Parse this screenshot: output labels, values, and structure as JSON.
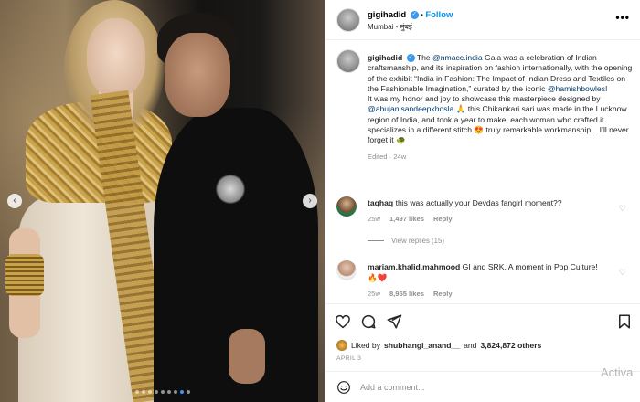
{
  "post": {
    "username": "gigihadid",
    "follow_label": "Follow",
    "location": "Mumbai - मुंबई",
    "more_icon": "more-horizontal-icon"
  },
  "caption": {
    "username": "gigihadid",
    "text_1": "The ",
    "mention_1": "@nmacc.india",
    "text_2": " Gala was a celebration of Indian craftsmanship, and its inspiration on fashion internationally, with the opening of the exhibit “India in Fashion: The Impact of Indian Dress and Textiles on the Fashionable Imagination,” curated by the iconic ",
    "mention_2": "@hamishbowles",
    "text_3": "!",
    "text_4": "It was my honor and joy to showcase this masterpiece designed by ",
    "mention_3": "@abujanisandeepkhosla",
    "text_5": " 🙏 this Chikankari sari was made in the Lucknow region of India, and took a year to make; each woman who crafted it specializes in a different stitch 😍 truly remarkable workmanship .. I’ll never forget it 🐢",
    "edited": "Edited · 24w"
  },
  "comments": [
    {
      "username": "taqhaq",
      "text": "this was actually your Devdas fangirl moment??",
      "age": "25w",
      "likes": "1,497 likes",
      "reply_label": "Reply"
    },
    {
      "username": "mariam.khalid.mahmood",
      "text": "GI and SRK. A moment in Pop Culture! 🔥❤️",
      "age": "25w",
      "likes": "8,955 likes",
      "reply_label": "Reply"
    }
  ],
  "view_replies": "View replies (15)",
  "likes": {
    "prefix": "Liked by",
    "user": "shubhangi_anand__",
    "middle": "and",
    "count": "3,824,872 others"
  },
  "date": "APRIL 3",
  "add_comment": {
    "placeholder": "Add a comment..."
  },
  "carousel": {
    "dot_count": 9,
    "active_index": 7
  },
  "watermark": "Activa"
}
